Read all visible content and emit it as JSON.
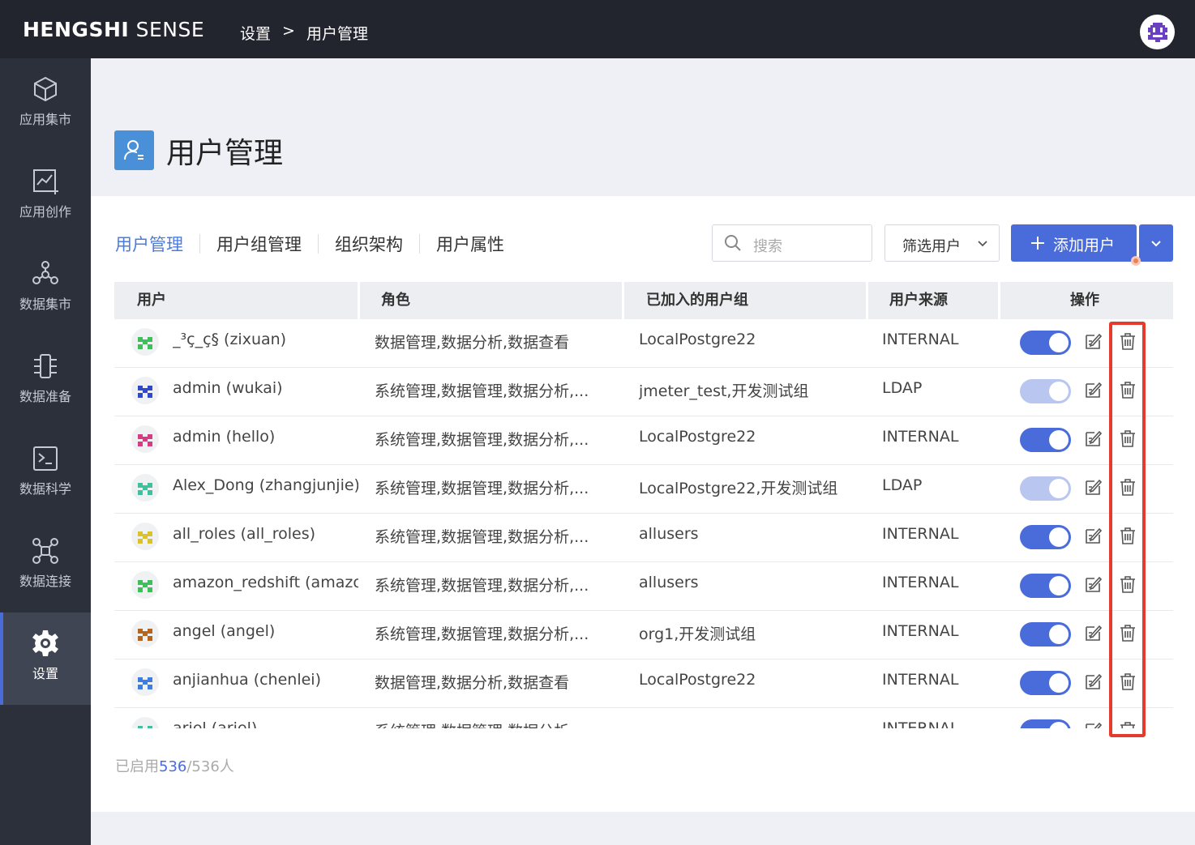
{
  "topbar": {
    "brand_bold": "HENGSHI",
    "brand_rest": " SENSE",
    "breadcrumb": [
      "设置",
      ">",
      "用户管理"
    ]
  },
  "sidebar": {
    "items": [
      {
        "label": "应用集市",
        "icon": "cube-icon"
      },
      {
        "label": "应用创作",
        "icon": "chart-edit-icon"
      },
      {
        "label": "数据集市",
        "icon": "hub-icon"
      },
      {
        "label": "数据准备",
        "icon": "pipeline-icon"
      },
      {
        "label": "数据科学",
        "icon": "terminal-icon"
      },
      {
        "label": "数据连接",
        "icon": "network-icon"
      },
      {
        "label": "设置",
        "icon": "gear-icon"
      }
    ]
  },
  "page": {
    "title": "用户管理"
  },
  "tabs": [
    "用户管理",
    "用户组管理",
    "组织架构",
    "用户属性"
  ],
  "toolbar": {
    "search_placeholder": "搜索",
    "filter_label": "筛选用户",
    "add_label": "添加用户"
  },
  "table": {
    "headers": [
      "用户",
      "角色",
      "已加入的用户组",
      "用户来源",
      "操作"
    ],
    "rows": [
      {
        "user": "_³ç_ç§ (zixuan)",
        "role": "数据管理,数据分析,数据查看",
        "groups": "LocalPostgre22",
        "source": "INTERNAL",
        "enabled": true,
        "avatar_color": "#3fbf5a"
      },
      {
        "user": "admin (wukai)",
        "role": "系统管理,数据管理,数据分析,...",
        "groups": "jmeter_test,开发测试组",
        "source": "LDAP",
        "enabled": false,
        "avatar_color": "#2f49c9"
      },
      {
        "user": "admin (hello)",
        "role": "系统管理,数据管理,数据分析,...",
        "groups": "LocalPostgre22",
        "source": "INTERNAL",
        "enabled": true,
        "avatar_color": "#d63c83"
      },
      {
        "user": "Alex_Dong (zhangjunjie)",
        "role": "系统管理,数据管理,数据分析,...",
        "groups": "LocalPostgre22,开发测试组",
        "source": "LDAP",
        "enabled": false,
        "avatar_color": "#3ec19c"
      },
      {
        "user": "all_roles (all_roles)",
        "role": "系统管理,数据管理,数据分析,...",
        "groups": "allusers",
        "source": "INTERNAL",
        "enabled": true,
        "avatar_color": "#d9c22b"
      },
      {
        "user": "amazon_redshift (amazon",
        "role": "系统管理,数据管理,数据分析,...",
        "groups": "allusers",
        "source": "INTERNAL",
        "enabled": true,
        "avatar_color": "#3fbf5a"
      },
      {
        "user": "angel (angel)",
        "role": "系统管理,数据管理,数据分析,...",
        "groups": "org1,开发测试组",
        "source": "INTERNAL",
        "enabled": true,
        "avatar_color": "#b5651d"
      },
      {
        "user": "anjianhua (chenlei)",
        "role": "数据管理,数据分析,数据查看",
        "groups": "LocalPostgre22",
        "source": "INTERNAL",
        "enabled": true,
        "avatar_color": "#3e7ee0"
      },
      {
        "user": "ariel (ariel)",
        "role": "系统管理,数据管理,数据分析,...",
        "groups": "",
        "source": "INTERNAL",
        "enabled": true,
        "avatar_color": "#3ec19c"
      }
    ]
  },
  "footer": {
    "prefix": "已启用",
    "enabled": "536",
    "total": "/536人"
  },
  "colors": {
    "accent": "#4a6cdb",
    "toggle_on": "#4a6cdb",
    "toggle_off": "#b9c6ef",
    "highlight": "#e53b2c"
  }
}
